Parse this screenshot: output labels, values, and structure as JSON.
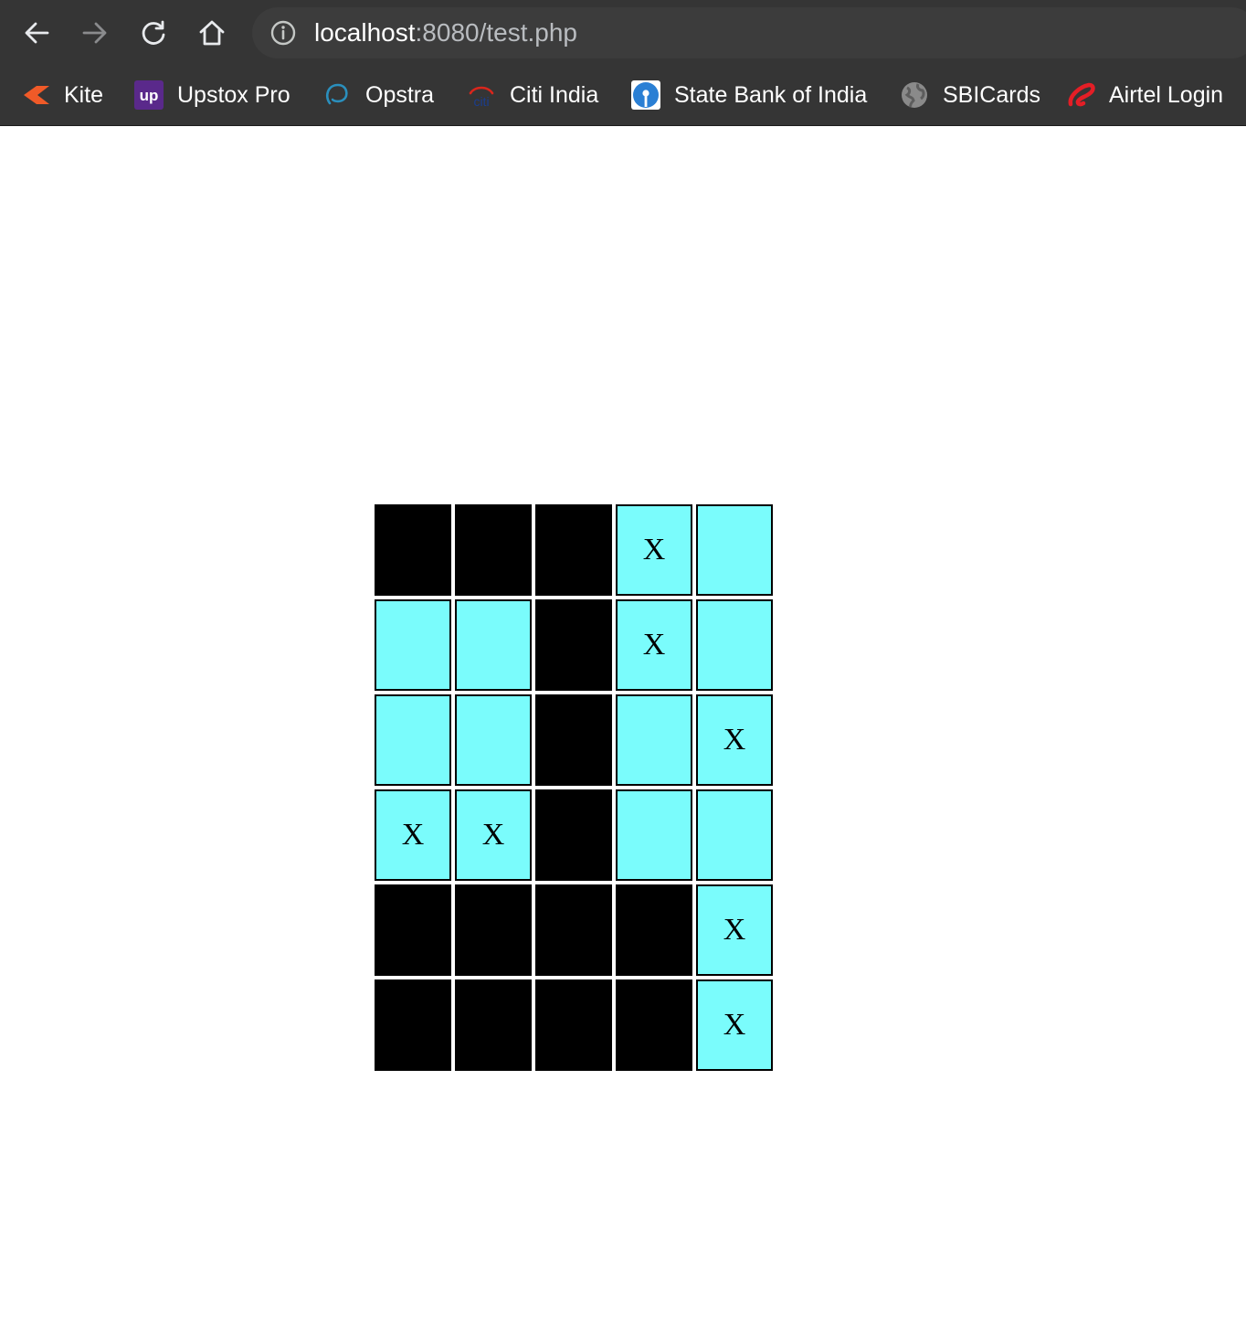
{
  "browser": {
    "url_host": "localhost",
    "url_rest": ":8080/test.php",
    "bookmarks": [
      {
        "label": "Kite",
        "icon": "kite-icon",
        "color": "#f05a28"
      },
      {
        "label": "Upstox Pro",
        "icon": "upstox-icon",
        "color": "#5a298b"
      },
      {
        "label": "Opstra",
        "icon": "opstra-icon",
        "color": "#2a8fbd"
      },
      {
        "label": "Citi India",
        "icon": "citi-icon",
        "color": "#1a3d8f"
      },
      {
        "label": "State Bank of India",
        "icon": "sbi-icon",
        "color": "#2a7fd4"
      },
      {
        "label": "SBICards",
        "icon": "globe-icon",
        "color": "#8a8a8a"
      },
      {
        "label": "Airtel Login",
        "icon": "airtel-icon",
        "color": "#e41e26"
      }
    ]
  },
  "colors": {
    "open_cell": "#7afcfc",
    "blocked_cell": "#000000"
  },
  "grid": {
    "rows": [
      [
        "B",
        "B",
        "B",
        "X",
        "O"
      ],
      [
        "O",
        "O",
        "B",
        "X",
        "O"
      ],
      [
        "O",
        "O",
        "B",
        "O",
        "X"
      ],
      [
        "X",
        "X",
        "B",
        "O",
        "O"
      ],
      [
        "B",
        "B",
        "B",
        "B",
        "X"
      ],
      [
        "B",
        "B",
        "B",
        "B",
        "X"
      ]
    ],
    "mark": "X"
  }
}
